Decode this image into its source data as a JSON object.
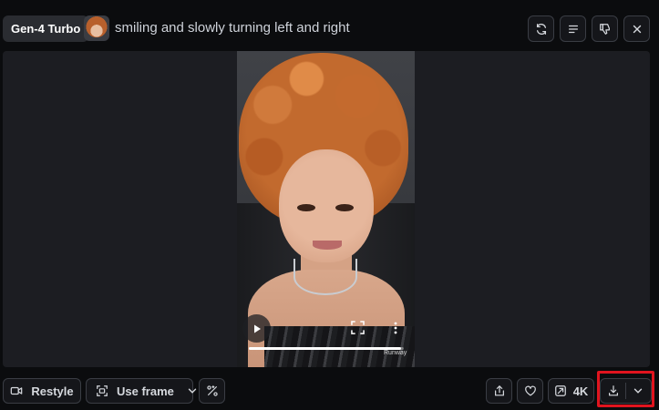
{
  "header": {
    "model": "Gen-4 Turbo",
    "prompt": "smiling and slowly turning left and right",
    "icons": [
      "refresh-icon",
      "details-lines-icon",
      "thumbs-down-icon",
      "close-icon"
    ]
  },
  "player": {
    "progress": 0.98,
    "watermark": "Runway"
  },
  "footer": {
    "restyle_label": "Restyle",
    "use_frame_label": "Use frame",
    "upscale_label": "4K"
  },
  "colors": {
    "background": "#0b0c0e",
    "panel": "#1c1d22",
    "button_border": "#3a3d44",
    "highlight": "#e0141e"
  }
}
